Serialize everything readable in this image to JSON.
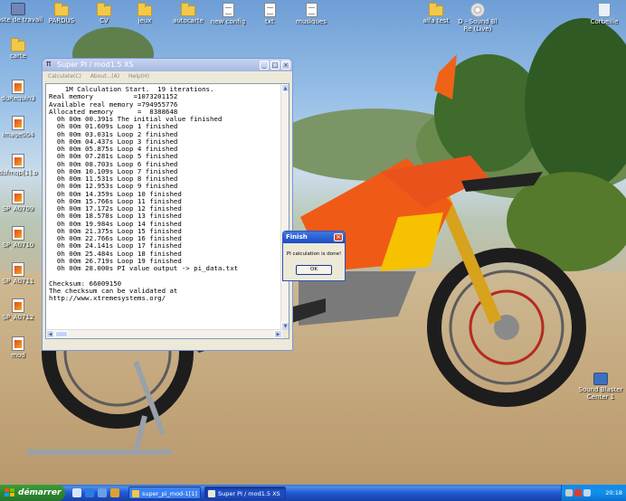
{
  "desktop": {
    "icons_top": [
      {
        "label": "Poste de travail",
        "icon": "computer-icon"
      },
      {
        "label": "PARDUS",
        "icon": "folder-icon"
      },
      {
        "label": "CV",
        "icon": "folder-icon"
      },
      {
        "label": "jeux",
        "icon": "folder-icon"
      },
      {
        "label": "autocarte",
        "icon": "folder-icon"
      },
      {
        "label": "new config",
        "icon": "document-icon"
      },
      {
        "label": "txt",
        "icon": "document-icon"
      },
      {
        "label": "musiques",
        "icon": "document-icon"
      },
      {
        "label": "alfa test",
        "icon": "folder-icon"
      },
      {
        "label": "D - Sound Bl\nRe (Live)",
        "icon": "dvd-icon"
      },
      {
        "label": "Corbeille",
        "icon": "recycle-bin-icon"
      }
    ],
    "icons_left": [
      {
        "label": "carte",
        "icon": "folder-icon"
      },
      {
        "label": "duRequin3",
        "icon": "image-icon"
      },
      {
        "label": "Image004",
        "icon": "image-icon"
      },
      {
        "label": "dsfmqp[1].p",
        "icon": "image-icon"
      },
      {
        "label": "SP_A0709",
        "icon": "image-icon"
      },
      {
        "label": "SP_A0710",
        "icon": "image-icon"
      },
      {
        "label": "SP_A0711",
        "icon": "image-icon"
      },
      {
        "label": "SP_A0712",
        "icon": "image-icon"
      },
      {
        "label": "mod",
        "icon": "image-icon"
      }
    ],
    "icon_right": {
      "label": "Sound Blaster\nCenter 1",
      "icon": "sound-blaster-icon"
    }
  },
  "superpi": {
    "title": "Super PI / mod1.5 XS",
    "menu": [
      "Calculate(C)",
      "About...(A)",
      "Help(H)"
    ],
    "console": "    1M Calculation Start.  19 iterations.\nReal memory          =1073201152\nAvailable real memory =794955776\nAllocated memory      =  8388648\n  0h 00m 00.391s The initial value finished\n  0h 00m 01.609s Loop 1 finished\n  0h 00m 03.031s Loop 2 finished\n  0h 00m 04.437s Loop 3 finished\n  0h 00m 05.875s Loop 4 finished\n  0h 00m 07.281s Loop 5 finished\n  0h 00m 08.703s Loop 6 finished\n  0h 00m 10.109s Loop 7 finished\n  0h 00m 11.531s Loop 8 finished\n  0h 00m 12.953s Loop 9 finished\n  0h 00m 14.359s Loop 10 finished\n  0h 00m 15.766s Loop 11 finished\n  0h 00m 17.172s Loop 12 finished\n  0h 00m 18.578s Loop 13 finished\n  0h 00m 19.984s Loop 14 finished\n  0h 00m 21.375s Loop 15 finished\n  0h 00m 22.766s Loop 16 finished\n  0h 00m 24.141s Loop 17 finished\n  0h 00m 25.484s Loop 18 finished\n  0h 00m 26.719s Loop 19 finished\n  0h 00m 28.000s PI value output -> pi_data.txt\n\nChecksum: 66009150\nThe checksum can be validated at\nhttp://www.xtremesystems.org/"
  },
  "finish_dialog": {
    "title": "Finish",
    "message": "PI calculation is done!",
    "ok_label": "OK"
  },
  "taskbar": {
    "start_label": "démarrer",
    "tasks": [
      {
        "label": "super_pi_mod-1[1]"
      },
      {
        "label": "Super PI / mod1.5 XS"
      }
    ],
    "clock": "20:18"
  }
}
